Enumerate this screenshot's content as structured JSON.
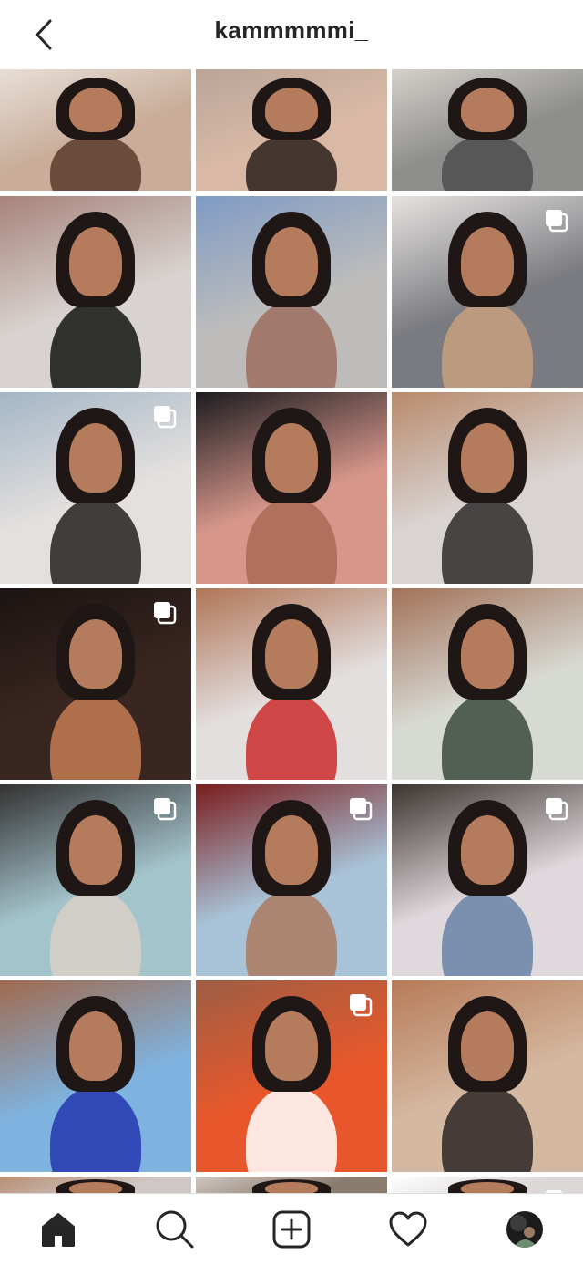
{
  "header": {
    "username": "kammmmmi_",
    "back_icon": "chevron-left-icon"
  },
  "posts": [
    {
      "id": 1,
      "colors": [
        "#c9ad99",
        "#5a3a2c",
        "#e8dfd8"
      ],
      "multi": false
    },
    {
      "id": 2,
      "colors": [
        "#d9b9a6",
        "#2c1f1b",
        "#b9a497"
      ],
      "multi": false
    },
    {
      "id": 3,
      "colors": [
        "#8e8e8c",
        "#4d4d4f",
        "#d6d2cc"
      ],
      "multi": false
    },
    {
      "id": 4,
      "colors": [
        "#d8d3d0",
        "#141414",
        "#a7837a"
      ],
      "multi": false
    },
    {
      "id": 5,
      "colors": [
        "#bdbcbb",
        "#9d6e5f",
        "#7f9bc4"
      ],
      "multi": false
    },
    {
      "id": 6,
      "colors": [
        "#7a7b80",
        "#c8a080",
        "#e6e2e0"
      ],
      "multi": true
    },
    {
      "id": 7,
      "colors": [
        "#e4e0de",
        "#23201f",
        "#a4b6c6"
      ],
      "multi": true
    },
    {
      "id": 8,
      "colors": [
        "#d6968a",
        "#a86a55",
        "#1b1b1f"
      ],
      "multi": false
    },
    {
      "id": 9,
      "colors": [
        "#d9d4d2",
        "#2d2a2b",
        "#b88a6c"
      ],
      "multi": false
    },
    {
      "id": 10,
      "colors": [
        "#3a2620",
        "#c47c52",
        "#1b1412"
      ],
      "multi": true
    },
    {
      "id": 11,
      "colors": [
        "#e3dfdf",
        "#cc2d2d",
        "#b07556"
      ],
      "multi": false
    },
    {
      "id": 12,
      "colors": [
        "#d7d9d3",
        "#3a4a3c",
        "#a27259"
      ],
      "multi": false
    },
    {
      "id": 13,
      "colors": [
        "#a4c4cc",
        "#d9d0c5",
        "#343232"
      ],
      "multi": true
    },
    {
      "id": 14,
      "colors": [
        "#a8c3d8",
        "#aa7a60",
        "#7a1c1c"
      ],
      "multi": true
    },
    {
      "id": 15,
      "colors": [
        "#dfd8dc",
        "#6a84a6",
        "#3c342f"
      ],
      "multi": true
    },
    {
      "id": 16,
      "colors": [
        "#7fb3df",
        "#2437b0",
        "#a06a4e"
      ],
      "multi": false
    },
    {
      "id": 17,
      "colors": [
        "#e8572b",
        "#ffffff",
        "#9e5e44"
      ],
      "multi": true
    },
    {
      "id": 18,
      "colors": [
        "#d4b8a1",
        "#2c2624",
        "#b77b58"
      ],
      "multi": false
    },
    {
      "id": 19,
      "colors": [
        "#cfc7c5",
        "#3a3333",
        "#b88e73"
      ],
      "multi": false
    },
    {
      "id": 20,
      "colors": [
        "#8b7c70",
        "#5a4a40",
        "#d0c7c0"
      ],
      "multi": false
    },
    {
      "id": 21,
      "colors": [
        "#dcd8d8",
        "#b8a89c",
        "#ffffff"
      ],
      "multi": true
    }
  ],
  "tab_bar": {
    "items": [
      {
        "name": "home-icon",
        "active": true
      },
      {
        "name": "search-icon",
        "active": false
      },
      {
        "name": "new-post-icon",
        "active": false
      },
      {
        "name": "activity-heart-icon",
        "active": false
      },
      {
        "name": "profile-avatar",
        "active": false
      }
    ]
  }
}
